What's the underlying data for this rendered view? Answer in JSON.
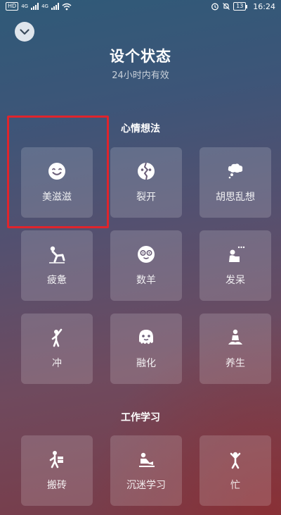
{
  "status_bar": {
    "hd_badge": "HD",
    "sim1_label": "4G",
    "sim2_label": "4G",
    "battery": "13",
    "time": "16:24"
  },
  "header": {
    "title": "设个状态",
    "subtitle": "24小时内有效"
  },
  "sections": [
    {
      "title": "心情想法",
      "items": [
        {
          "label": "美滋滋",
          "icon": "smile-face-icon"
        },
        {
          "label": "裂开",
          "icon": "cracked-face-icon"
        },
        {
          "label": "胡思乱想",
          "icon": "thought-bubble-icon"
        },
        {
          "label": "疲惫",
          "icon": "tired-person-icon"
        },
        {
          "label": "数羊",
          "icon": "sheep-face-icon"
        },
        {
          "label": "发呆",
          "icon": "daze-person-icon"
        },
        {
          "label": "冲",
          "icon": "cheering-person-icon"
        },
        {
          "label": "融化",
          "icon": "melting-face-icon"
        },
        {
          "label": "养生",
          "icon": "meditating-person-icon"
        }
      ]
    },
    {
      "title": "工作学习",
      "items": [
        {
          "label": "搬砖",
          "icon": "carrying-bricks-icon"
        },
        {
          "label": "沉迷学习",
          "icon": "studying-person-icon"
        },
        {
          "label": "忙",
          "icon": "busy-person-icon"
        }
      ]
    }
  ],
  "colors": {
    "highlight_border": "#e0242c",
    "tile_background": "rgba(255,255,255,0.16)"
  }
}
